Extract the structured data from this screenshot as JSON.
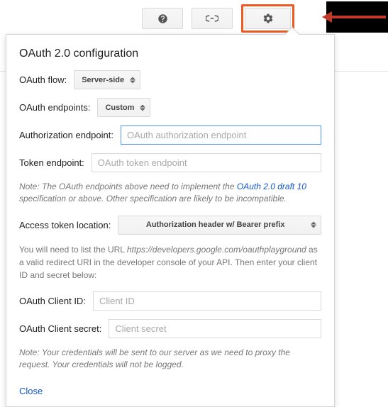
{
  "topbar": {
    "help_icon": "help-icon",
    "link_icon": "link-icon",
    "gear_icon": "gear-icon"
  },
  "panel": {
    "title": "OAuth 2.0 configuration",
    "flow": {
      "label": "OAuth flow:",
      "value": "Server-side"
    },
    "endpoints": {
      "label": "OAuth endpoints:",
      "value": "Custom"
    },
    "authz": {
      "label": "Authorization endpoint:",
      "placeholder": "OAuth authorization endpoint",
      "value": ""
    },
    "token": {
      "label": "Token endpoint:",
      "placeholder": "OAuth token endpoint",
      "value": ""
    },
    "note1_pre": "Note: The OAuth endpoints above need to implement the ",
    "note1_link": "OAuth 2.0 draft 10",
    "note1_post": " specification or above. Other specification are likely to be incompatible.",
    "token_loc": {
      "label": "Access token location:",
      "value": "Authorization header w/ Bearer prefix"
    },
    "info_pre": "You will need to list the URL ",
    "info_url": "https://developers.google.com/oauthplayground",
    "info_post": " as a valid redirect URI in the developer console of your API. Then enter your client ID and secret below:",
    "client_id": {
      "label": "OAuth Client ID:",
      "placeholder": "Client ID",
      "value": ""
    },
    "client_secret": {
      "label": "OAuth Client secret:",
      "placeholder": "Client secret",
      "value": ""
    },
    "note2": "Note: Your credentials will be sent to our server as we need to proxy the request. Your credentials will not be logged.",
    "close": "Close"
  }
}
